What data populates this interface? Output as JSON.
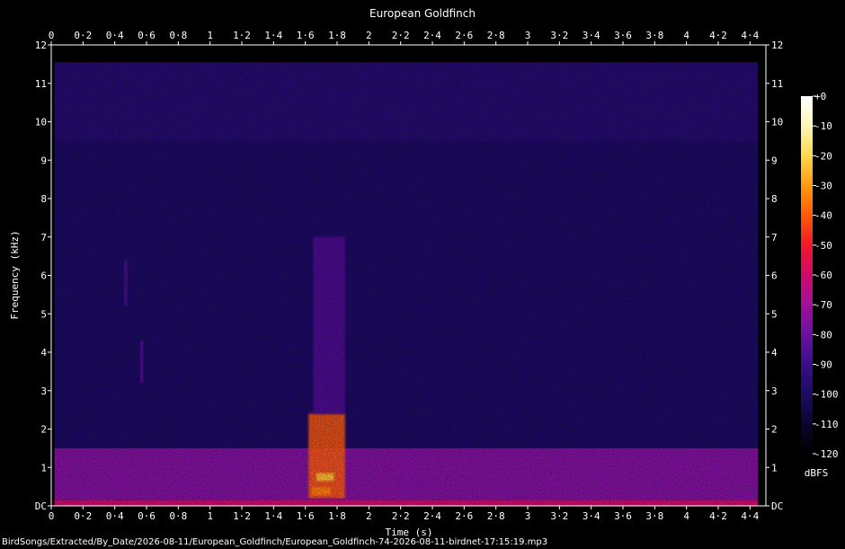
{
  "chart_data": {
    "type": "heatmap",
    "title": "European Goldfinch",
    "xlabel": "Time (s)",
    "ylabel": "Frequency (kHz)",
    "xlim": [
      0,
      4.5
    ],
    "ylim": [
      0,
      12
    ],
    "x_ticks": [
      "0",
      "0·2",
      "0·4",
      "0·6",
      "0·8",
      "1",
      "1·2",
      "1·4",
      "1·6",
      "1·8",
      "2",
      "2·2",
      "2·4",
      "2·6",
      "2·8",
      "3",
      "3·2",
      "3·4",
      "3·6",
      "3·8",
      "4",
      "4·2",
      "4·4"
    ],
    "x_tick_values": [
      0,
      0.2,
      0.4,
      0.6,
      0.8,
      1.0,
      1.2,
      1.4,
      1.6,
      1.8,
      2.0,
      2.2,
      2.4,
      2.6,
      2.8,
      3.0,
      3.2,
      3.4,
      3.6,
      3.8,
      4.0,
      4.2,
      4.4
    ],
    "y_ticks": [
      "DC",
      "1",
      "2",
      "3",
      "4",
      "5",
      "6",
      "7",
      "8",
      "9",
      "10",
      "11",
      "12"
    ],
    "y_tick_values": [
      0,
      1,
      2,
      3,
      4,
      5,
      6,
      7,
      8,
      9,
      10,
      11,
      12
    ],
    "colorbar": {
      "label": "dBFS",
      "ticks": [
        "+0",
        "-10",
        "-20",
        "-30",
        "-40",
        "-50",
        "-60",
        "-70",
        "-80",
        "-90",
        "-100",
        "-110",
        "-120"
      ],
      "tick_values": [
        0,
        -10,
        -20,
        -30,
        -40,
        -50,
        -60,
        -70,
        -80,
        -90,
        -100,
        -110,
        -120
      ],
      "range": [
        -120,
        0
      ],
      "colors": [
        "#000000",
        "#0a0530",
        "#1d0a63",
        "#3a0f8a",
        "#6a11a0",
        "#a0109a",
        "#d00a6a",
        "#f2182a",
        "#ff5a08",
        "#ff9a10",
        "#ffd84a",
        "#fff5b8",
        "#ffffff"
      ]
    },
    "signal_content": {
      "max_frequency_khz": 11.55,
      "low_frequency_noise_band_khz": [
        0,
        1.5
      ],
      "calls": [
        {
          "start_s": 1.62,
          "end_s": 1.85,
          "freq_khz": [
            0.2,
            2.4
          ],
          "level_dbfs": -40
        },
        {
          "start_s": 1.65,
          "end_s": 1.85,
          "freq_khz": [
            2.4,
            7.0
          ],
          "level_dbfs": -85
        },
        {
          "start_s": 0.46,
          "end_s": 0.48,
          "freq_khz": [
            5.2,
            6.4
          ],
          "level_dbfs": -85
        },
        {
          "start_s": 0.56,
          "end_s": 0.58,
          "freq_khz": [
            3.2,
            4.3
          ],
          "level_dbfs": -82
        }
      ],
      "loudest_bands": [
        {
          "time_s": [
            1.67,
            1.78
          ],
          "freq_khz": [
            0.65,
            0.85
          ],
          "level_dbfs": -25
        },
        {
          "time_s": [
            1.64,
            1.76
          ],
          "freq_khz": [
            0.28,
            0.48
          ],
          "level_dbfs": -35
        }
      ]
    }
  },
  "footer": {
    "file_path": "BirdSongs/Extracted/By_Date/2026-08-11/European_Goldfinch/European_Goldfinch-74-2026-08-11-birdnet-17:15:19.mp3"
  }
}
